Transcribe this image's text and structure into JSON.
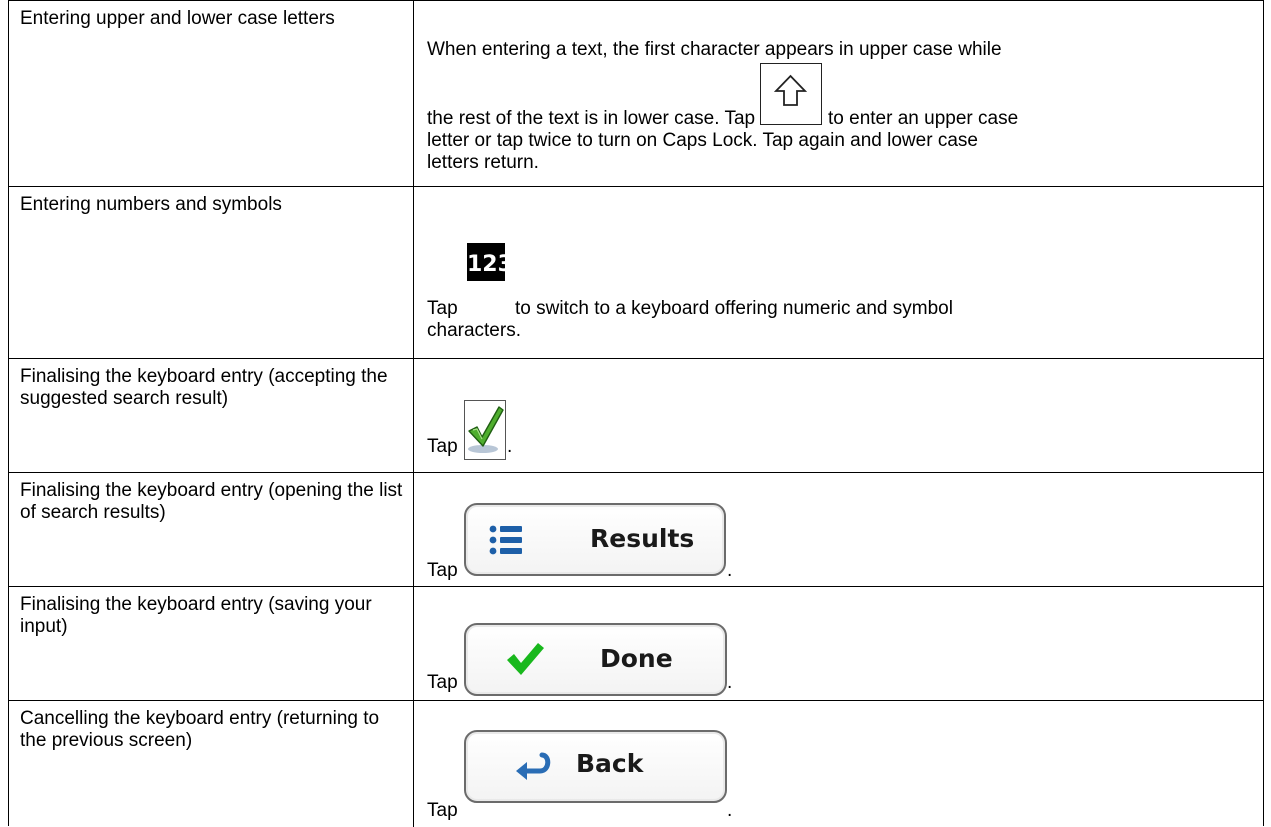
{
  "rows": [
    {
      "label": "Entering upper and lower case letters",
      "text_line1": "When entering a text, the first character appears in upper case while",
      "text_line2_pre": "the rest of the text is in lower case. Tap",
      "text_line2_post": "to enter an upper case",
      "text_line3": "letter or tap twice to turn on Caps Lock. Tap again and lower case",
      "text_line4": "letters return.",
      "icon": "shift-arrow-icon"
    },
    {
      "label": "Entering numbers and symbols",
      "text_pre": "Tap",
      "button_label": "123",
      "text_post": "to switch to a keyboard offering numeric and symbol",
      "text_line2": "characters."
    },
    {
      "label": "Finalising the keyboard entry (accepting the suggested search result)",
      "text_pre": "Tap",
      "text_post": ".",
      "icon": "green-checkmark-icon"
    },
    {
      "label": "Finalising the keyboard entry (opening the list of search results)",
      "text_pre": "Tap",
      "button_label": "Results",
      "text_post": ".",
      "icon": "list-icon"
    },
    {
      "label": "Finalising the keyboard entry (saving your input)",
      "text_pre": "Tap",
      "button_label": "Done",
      "text_post": ".",
      "icon": "checkmark-icon"
    },
    {
      "label": "Cancelling the keyboard entry (returning to the previous screen)",
      "text_pre": "Tap",
      "button_label": "Back",
      "text_post": ".",
      "icon": "back-arrow-icon"
    }
  ],
  "colors": {
    "border": "#000000",
    "list_icon_blue": "#1d5fa8",
    "done_check_green": "#19b81d",
    "back_arrow_blue": "#2a6db5"
  }
}
